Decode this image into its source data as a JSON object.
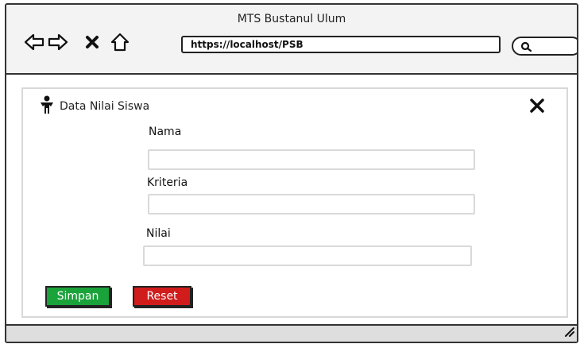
{
  "window": {
    "title": "MTS Bustanul Ulum"
  },
  "browser": {
    "url": "https://localhost/PSB",
    "nav": {
      "back_icon": "arrow-left-icon",
      "forward_icon": "arrow-right-icon",
      "stop_icon": "close-icon",
      "home_icon": "home-icon"
    },
    "search_icon": "search-icon"
  },
  "form": {
    "title": "Data Nilai Siswa",
    "title_icon": "person-icon",
    "close_icon": "close-icon",
    "fields": [
      {
        "label": "Nama",
        "value": ""
      },
      {
        "label": "Kriteria",
        "value": ""
      },
      {
        "label": "Nilai",
        "value": ""
      }
    ],
    "buttons": {
      "save_label": "Simpan",
      "reset_label": "Reset"
    }
  },
  "colors": {
    "save": "#1aa33a",
    "reset": "#d11c1c"
  }
}
